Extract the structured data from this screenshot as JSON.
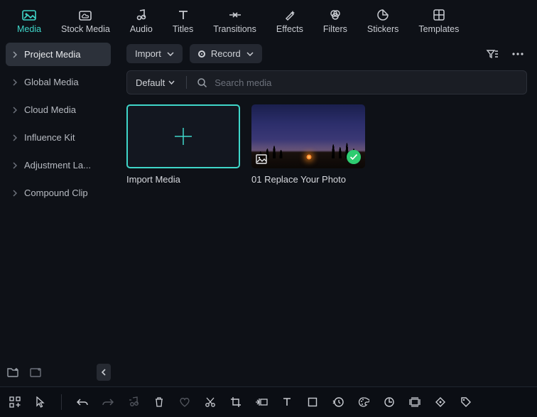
{
  "tabs": [
    {
      "label": "Media"
    },
    {
      "label": "Stock Media"
    },
    {
      "label": "Audio"
    },
    {
      "label": "Titles"
    },
    {
      "label": "Transitions"
    },
    {
      "label": "Effects"
    },
    {
      "label": "Filters"
    },
    {
      "label": "Stickers"
    },
    {
      "label": "Templates"
    }
  ],
  "sidebar": {
    "items": [
      {
        "label": "Project Media"
      },
      {
        "label": "Global Media"
      },
      {
        "label": "Cloud Media"
      },
      {
        "label": "Influence Kit"
      },
      {
        "label": "Adjustment La..."
      },
      {
        "label": "Compound Clip"
      }
    ]
  },
  "toolbar": {
    "import_label": "Import",
    "record_label": "Record",
    "default_label": "Default",
    "search_placeholder": "Search media"
  },
  "media": {
    "import_card_label": "Import Media",
    "clip1_label": "01 Replace Your Photo"
  }
}
